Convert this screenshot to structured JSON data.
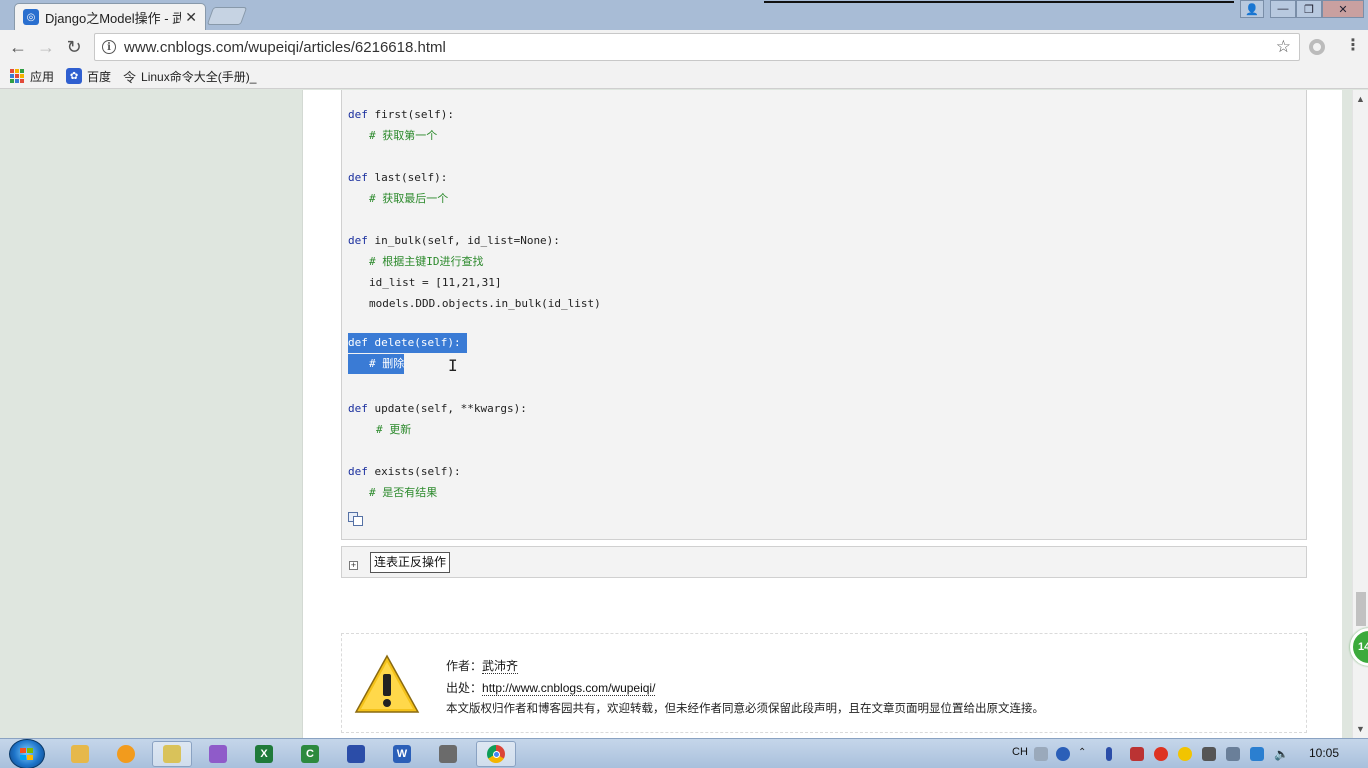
{
  "browser": {
    "tab_title": "Django之Model操作 - 武",
    "tab_close": "✕",
    "url": "www.cnblogs.com/wupeiqi/articles/6216618.html",
    "bookmarks": [
      {
        "label": "应用",
        "icon": "apps-grid-icon"
      },
      {
        "label": "百度",
        "icon": "paw-icon"
      },
      {
        "label": "Linux命令大全(手册)_",
        "icon": "ling-icon"
      }
    ]
  },
  "code": {
    "lines": [
      {
        "kw": "def",
        "text": " first(self):",
        "indent": 0,
        "selected": false
      },
      {
        "kw": "",
        "text": "# 获取第一个",
        "indent": 1,
        "selected": false
      },
      {
        "kw": "def",
        "text": " last(self):",
        "indent": 0,
        "selected": false
      },
      {
        "kw": "",
        "text": "# 获取最后一个",
        "indent": 1,
        "selected": false
      },
      {
        "kw": "def",
        "text": " in_bulk(self, id_list=None):",
        "indent": 0,
        "selected": false
      },
      {
        "kw": "",
        "text": "# 根据主键ID进行查找",
        "indent": 1,
        "selected": false
      },
      {
        "kw": "",
        "text": "id_list = [11,21,31]",
        "indent": 1,
        "selected": false,
        "plain": true
      },
      {
        "kw": "",
        "text": "models.DDD.objects.in_bulk(id_list)",
        "indent": 1,
        "selected": false,
        "plain": true
      },
      {
        "kw": "def",
        "text": " delete(self):",
        "indent": 0,
        "selected": true
      },
      {
        "kw": "",
        "text": "# 删除",
        "indent": 1,
        "selected": true
      },
      {
        "kw": "def",
        "text": " update(self, **kwargs):",
        "indent": 0,
        "selected": false
      },
      {
        "kw": "",
        "text": "# 更新",
        "indent": 2,
        "selected": false
      },
      {
        "kw": "def",
        "text": " exists(self):",
        "indent": 0,
        "selected": false
      },
      {
        "kw": "",
        "text": "# 是否有结果",
        "indent": 1,
        "selected": false
      }
    ]
  },
  "expander": {
    "plus": "+",
    "label": "连表正反操作"
  },
  "notice": {
    "author_prefix": "作者：",
    "author": "武沛齐",
    "source_prefix": "出处：",
    "source": "http://www.cnblogs.com/wupeiqi/",
    "copyright": "本文版权归作者和博客园共有，欢迎转载，但未经作者同意必须保留此段声明，且在文章页面明显位置给出原文连接。"
  },
  "floating_badge": "14",
  "taskbar": {
    "tray_lang": "CH",
    "clock": "10:05"
  },
  "colors": {
    "keyword": "#1a2f9e",
    "comment": "#2c8a2c",
    "selection": "#3a7bd5",
    "sidebar_bg": "#dfe6df"
  }
}
